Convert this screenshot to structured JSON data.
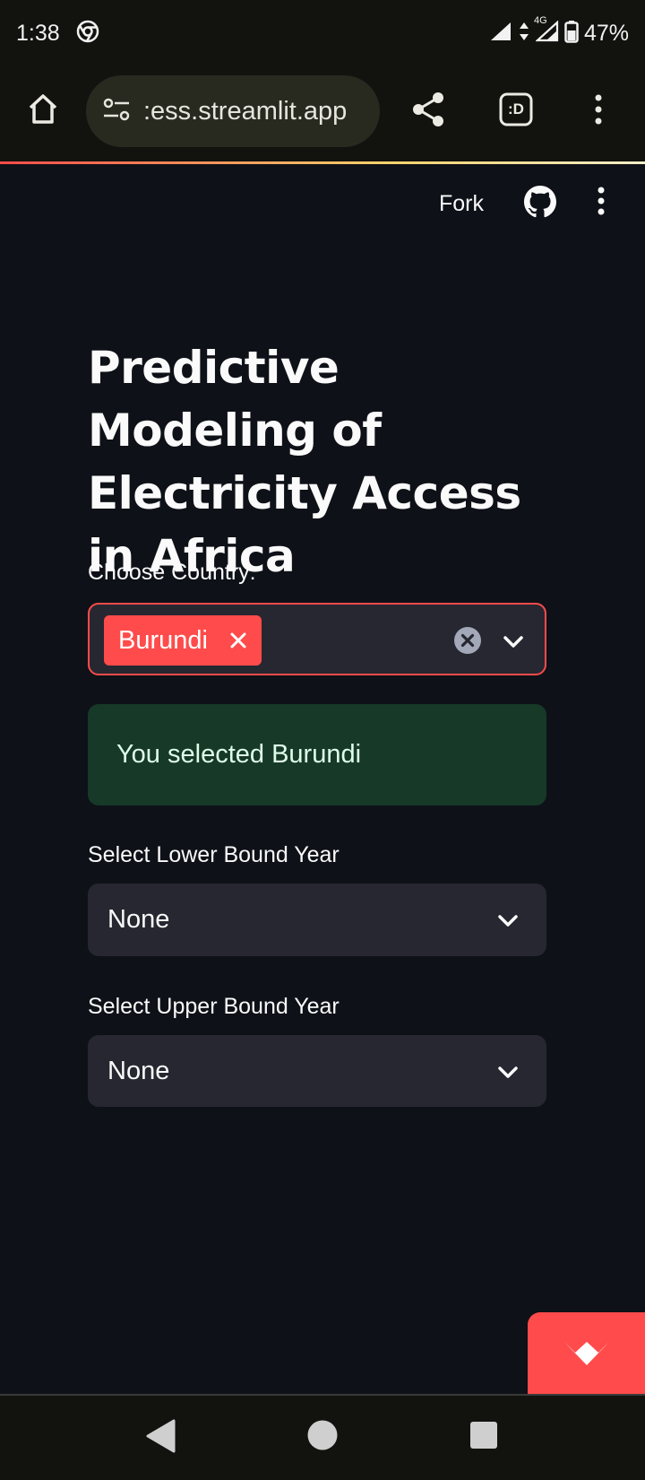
{
  "status_bar": {
    "time": "1:38",
    "network": "4G",
    "battery": "47%",
    "icons": [
      "chrome-icon",
      "wifi-signal-icon",
      "data-arrows-icon",
      "cell-signal-icon",
      "battery-icon"
    ]
  },
  "browser": {
    "url": ":ess.streamlit.app",
    "tab_switcher_label": ":D",
    "icons": [
      "home-icon",
      "site-settings-icon",
      "share-icon",
      "tab-switcher-icon",
      "more-vert-icon"
    ]
  },
  "app_header": {
    "fork_label": "Fork",
    "icons": [
      "github-icon",
      "more-vert-icon"
    ]
  },
  "main": {
    "title": "Predictive Modeling of Electricity Access in Africa",
    "country": {
      "label": "Choose Country:",
      "selected_tag": "Burundi"
    },
    "alert": {
      "text": "You selected Burundi",
      "color": "#173928"
    },
    "lower_year": {
      "label": "Select Lower Bound Year",
      "value": "None"
    },
    "upper_year": {
      "label": "Select Upper Bound Year",
      "value": "None"
    }
  },
  "colors": {
    "accent": "#ff4b4b",
    "background": "#0e1117",
    "widget_bg": "#262730",
    "success_bg": "#173928",
    "success_text": "#dffde9"
  },
  "nav_bar": {
    "icons": [
      "back-icon",
      "home-circle-icon",
      "recents-square-icon"
    ]
  }
}
